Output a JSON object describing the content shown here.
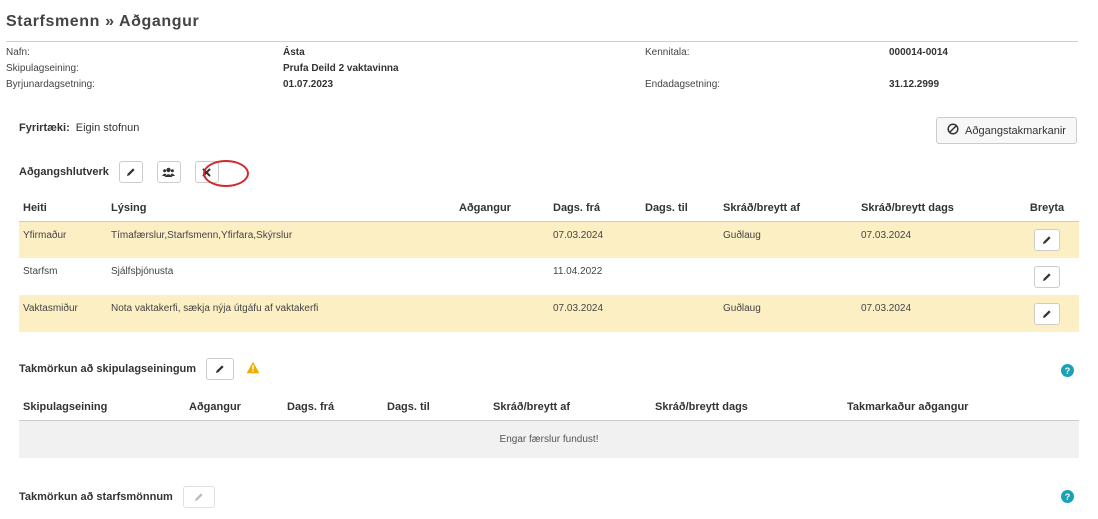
{
  "page": {
    "title": "Starfsmenn » Aðgangur"
  },
  "info": {
    "rows": [
      {
        "label1": "Nafn:",
        "value1": "Ásta",
        "label2": "Kennitala:",
        "value2": "000014-0014"
      },
      {
        "label1": "Skipulagseining:",
        "value1": "Prufa Deild 2 vaktavinna",
        "label2": "",
        "value2": ""
      },
      {
        "label1": "Byrjunardagsetning:",
        "value1": "01.07.2023",
        "label2": "Endadagsetning:",
        "value2": "31.12.2999"
      }
    ]
  },
  "company": {
    "label": "Fyrirtæki:",
    "value": "Eigin stofnun"
  },
  "restrictions_button": {
    "label": "Aðgangstakmarkanir",
    "icon": "ban-icon"
  },
  "roles": {
    "title": "Aðgangshlutverk",
    "columns": [
      "Heiti",
      "Lýsing",
      "Aðgangur",
      "Dags. frá",
      "Dags. til",
      "Skráð/breytt af",
      "Skráð/breytt dags",
      "Breyta"
    ],
    "rows": [
      {
        "heiti": "Yfirmaður",
        "lysing": "Tímafærslur,Starfsmenn,Yfirfara,Skýrslur",
        "adgangur": "",
        "fra": "07.03.2024",
        "til": "",
        "af": "Guðlaug",
        "dags": "07.03.2024",
        "highlight": true
      },
      {
        "heiti": "Starfsm",
        "lysing": "Sjálfsþjónusta",
        "adgangur": "",
        "fra": "11.04.2022",
        "til": "",
        "af": "",
        "dags": "",
        "highlight": false
      },
      {
        "heiti": "Vaktasmiður",
        "lysing": "Nota vaktakerfi, sækja nýja útgáfu af vaktakerfi",
        "adgangur": "",
        "fra": "07.03.2024",
        "til": "",
        "af": "Guðlaug",
        "dags": "07.03.2024",
        "highlight": true
      }
    ]
  },
  "units": {
    "title": "Takmörkun að skipulagseiningum",
    "columns": [
      "Skipulagseining",
      "Aðgangur",
      "Dags. frá",
      "Dags. til",
      "Skráð/breytt af",
      "Skráð/breytt dags",
      "Takmarkaður aðgangur"
    ],
    "empty_text": "Engar færslur fundust!"
  },
  "employees": {
    "title": "Takmörkun að starfsmönnum"
  },
  "colors": {
    "highlight_row": "#fcefc4",
    "help": "#17a2b8",
    "warning": "#f0ad00",
    "annotation": "#d0292c"
  }
}
